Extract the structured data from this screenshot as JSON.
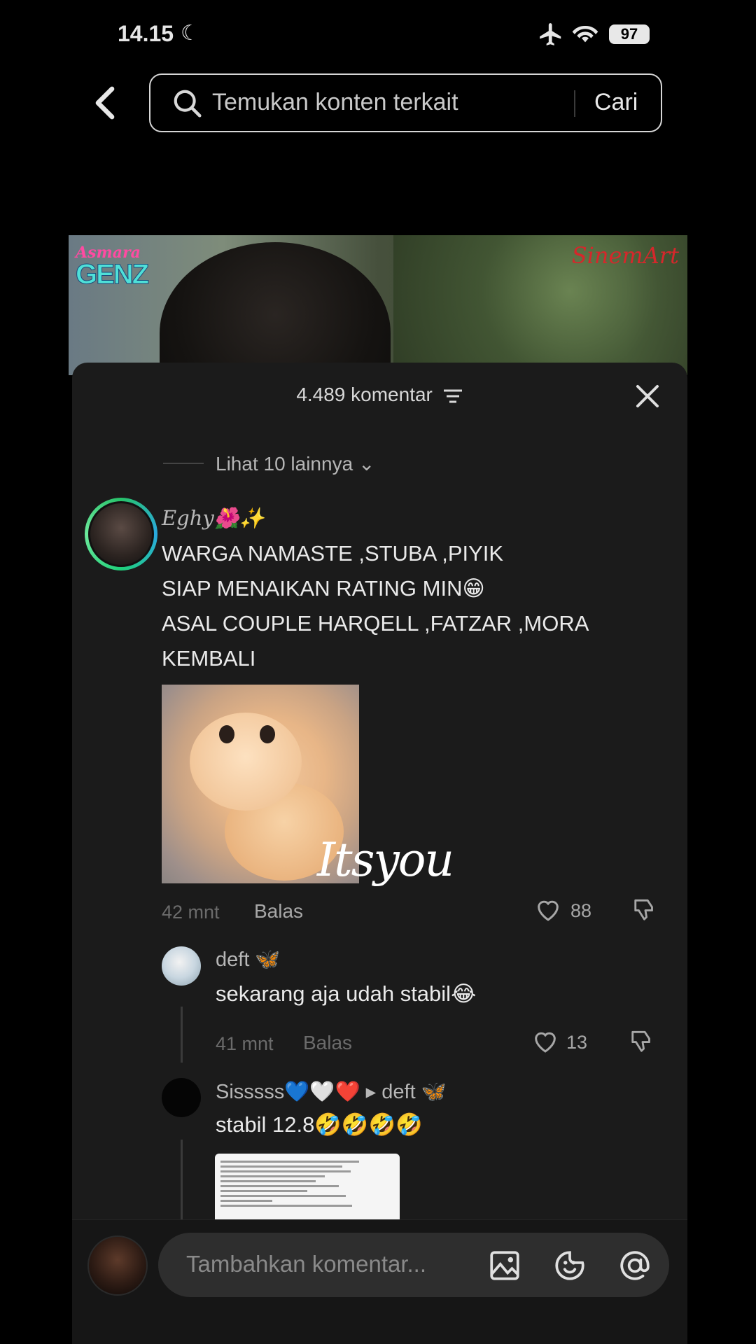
{
  "status": {
    "time": "14.15",
    "battery": "97"
  },
  "search": {
    "placeholder": "Temukan konten terkait",
    "button": "Cari"
  },
  "video": {
    "logo_top": "Asmara",
    "logo_bottom": "GENZ",
    "brand": "SinemArt"
  },
  "comments": {
    "count_label": "4.489 komentar",
    "more_replies": "Lihat 10 lainnya",
    "main": {
      "username": "Eghy🌺✨",
      "text": "WARGA NAMASTE ,STUBA ,PIYIK\nSIAP MENAIKAN RATING MIN😁\nASAL COUPLE HARQELL ,FATZAR ,MORA KEMBALI",
      "time": "42 mnt",
      "reply_label": "Balas",
      "likes": "88"
    },
    "replies": [
      {
        "username": "deft 🦋",
        "text": "sekarang aja udah stabil😂",
        "time": "41 mnt",
        "reply_label": "Balas",
        "likes": "13"
      },
      {
        "username": "Sisssss💙🤍❤️ ▸ deft 🦋",
        "text": "stabil 12.8🤣🤣🤣🤣"
      }
    ]
  },
  "watermark": "Itsyou",
  "composer": {
    "placeholder": "Tambahkan komentar..."
  }
}
